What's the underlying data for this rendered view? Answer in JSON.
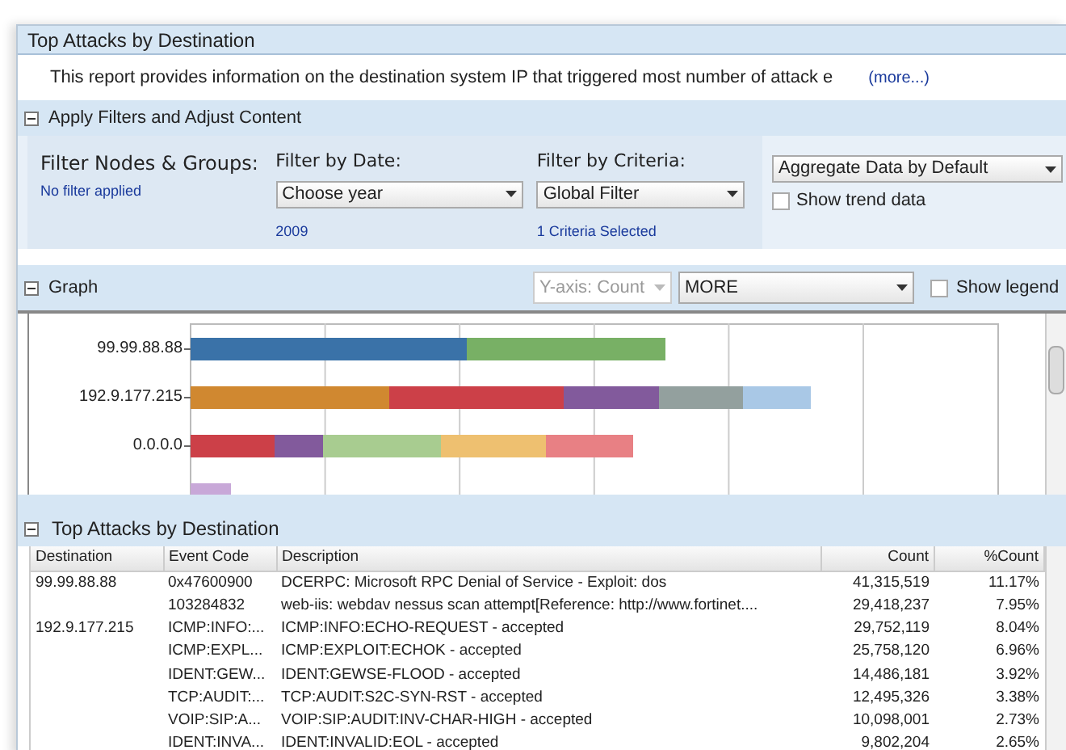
{
  "report": {
    "title": "Top Attacks by Destination",
    "description": "This report provides information on the destination system IP that triggered most number of attack e",
    "more_link": "(more...)"
  },
  "filters": {
    "title": "Apply Filters and Adjust Content",
    "expanded": true,
    "nodes": {
      "label": "Filter Nodes & Groups:",
      "value": "No filter applied"
    },
    "date": {
      "label": "Filter by Date:",
      "select": "Choose year",
      "value": "2009"
    },
    "criteria": {
      "label": "Filter by Criteria:",
      "select": "Global Filter",
      "value": "1 Criteria Selected"
    },
    "aggregate": {
      "select": "Aggregate Data by Default"
    },
    "trend": {
      "label": "Show trend data",
      "checked": false
    }
  },
  "graph": {
    "title": "Graph",
    "expanded": true,
    "yaxis": {
      "select": "Y-axis: Count",
      "disabled": true
    },
    "more": {
      "select": "MORE"
    },
    "legend": {
      "label": "Show legend",
      "checked": false
    },
    "categories": [
      "99.99.88.88",
      "192.9.177.215",
      "0.0.0.0"
    ]
  },
  "table": {
    "title": "Top Attacks by Destination",
    "expanded": true,
    "columns": [
      "Destination",
      "Event Code",
      "Description",
      "Count",
      "%Count"
    ],
    "rows": [
      [
        "99.99.88.88",
        "0x47600900",
        "DCERPC: Microsoft RPC Denial of Service - Exploit: dos",
        "41,315,519",
        "11.17%"
      ],
      [
        "",
        "103284832",
        "web-iis: webdav nessus scan attempt[Reference: http://www.fortinet....",
        "29,418,237",
        "7.95%"
      ],
      [
        "192.9.177.215",
        "ICMP:INFO:...",
        "ICMP:INFO:ECHO-REQUEST - accepted",
        "29,752,119",
        "8.04%"
      ],
      [
        "",
        "ICMP:EXPL...",
        "ICMP:EXPLOIT:ECHOK - accepted",
        "25,758,120",
        "6.96%"
      ],
      [
        "",
        "IDENT:GEW...",
        "IDENT:GEWSE-FLOOD - accepted",
        "14,486,181",
        "3.92%"
      ],
      [
        "",
        "TCP:AUDIT:...",
        "TCP:AUDIT:S2C-SYN-RST - accepted",
        "12,495,326",
        "3.38%"
      ],
      [
        "",
        "VOIP:SIP:A...",
        "VOIP:SIP:AUDIT:INV-CHAR-HIGH - accepted",
        "10,098,001",
        "2.73%"
      ],
      [
        "",
        "IDENT:INVA...",
        "IDENT:INVALID:EOL - accepted",
        "9,802,204",
        "2.65%"
      ]
    ]
  }
}
